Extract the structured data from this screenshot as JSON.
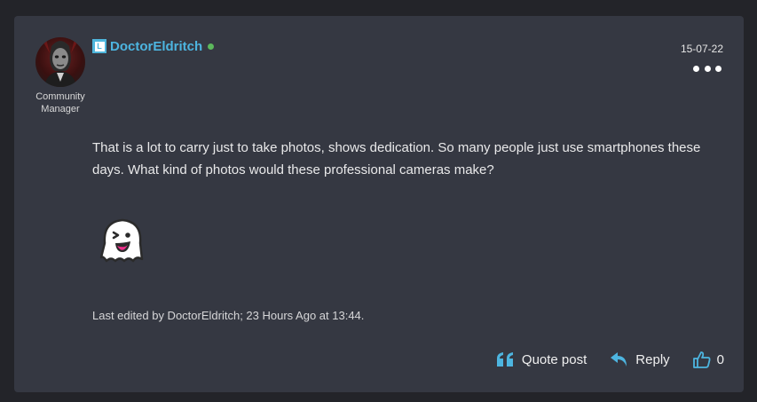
{
  "post": {
    "username": "DoctorEldritch",
    "rank_badge": "L",
    "role": "Community Manager",
    "date": "15-07-22",
    "online": true,
    "body": "That is a lot to carry just to take photos, shows dedication. So many people just use smartphones these days. What kind of photos would these professional cameras make?",
    "emoji": "ghost-emoji",
    "edited_note": "Last edited by DoctorEldritch; 23 Hours Ago at 13:44."
  },
  "actions": {
    "quote_label": "Quote post",
    "reply_label": "Reply",
    "like_count": "0"
  },
  "colors": {
    "background": "#232429",
    "card": "#353842",
    "accent": "#4db5e0",
    "online": "#5cb85c"
  },
  "icons": {
    "more": "more-dots-icon",
    "quote": "quote-icon",
    "reply": "reply-arrow-icon",
    "like": "thumbs-up-icon"
  }
}
